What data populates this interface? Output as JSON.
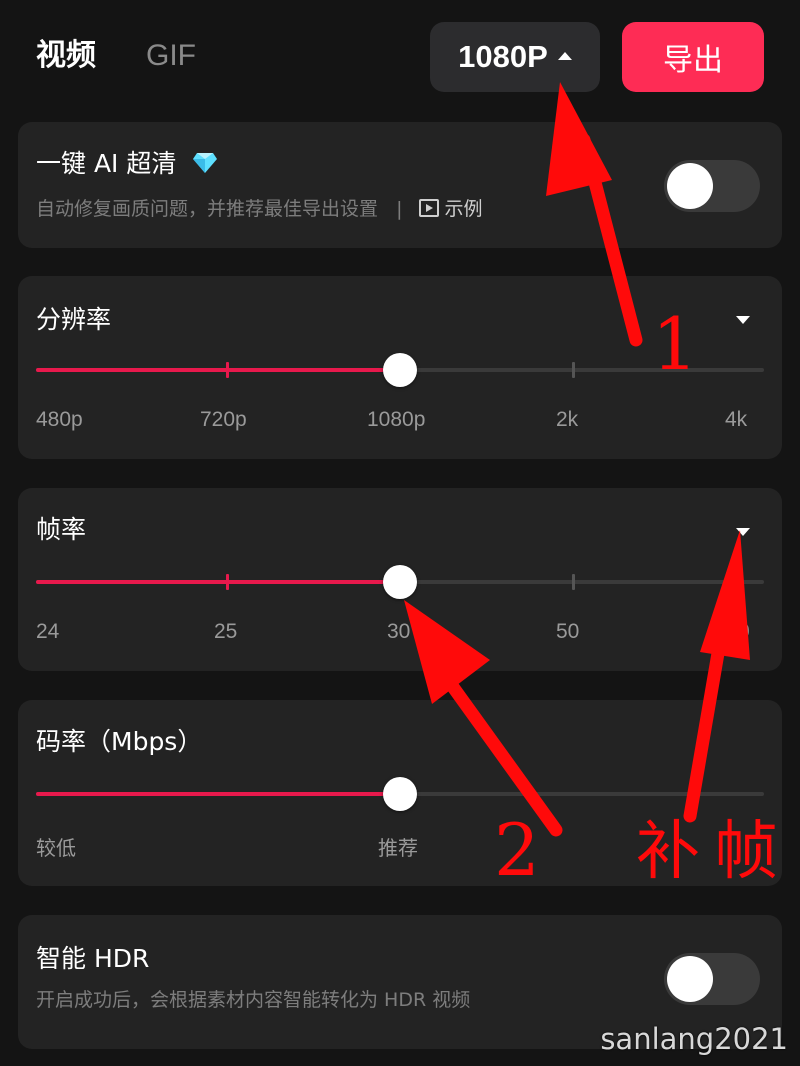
{
  "header": {
    "tabs": [
      "视频",
      "GIF"
    ],
    "resolution_button": "1080P",
    "export_button": "导出"
  },
  "ai_hd": {
    "title": "一键 AI 超清",
    "description": "自动修复画质问题，并推荐最佳导出设置",
    "separator": "|",
    "example_label": "示例",
    "enabled": false
  },
  "resolution": {
    "title": "分辨率",
    "options": [
      "480p",
      "720p",
      "1080p",
      "2k",
      "4k"
    ],
    "selected_index": 2
  },
  "frame_rate": {
    "title": "帧率",
    "options": [
      "24",
      "25",
      "30",
      "50",
      "0"
    ],
    "selected_index": 2
  },
  "bitrate": {
    "title": "码率（Mbps）",
    "labels": [
      "较低",
      "推荐"
    ],
    "value_fraction": 0.5
  },
  "smart_hdr": {
    "title": "智能 HDR",
    "description": "开启成功后，会根据素材内容智能转化为 HDR 视频",
    "enabled": false
  },
  "annotations": {
    "arrow_1_label": "1",
    "arrow_2_label": "2",
    "interp_label": "补帧",
    "color": "#ff0a0a"
  },
  "watermark": "sanlang2021",
  "colors": {
    "accent": "#fe2c55",
    "slider_fill": "#e8194c",
    "background": "#141414",
    "card": "#232323"
  }
}
